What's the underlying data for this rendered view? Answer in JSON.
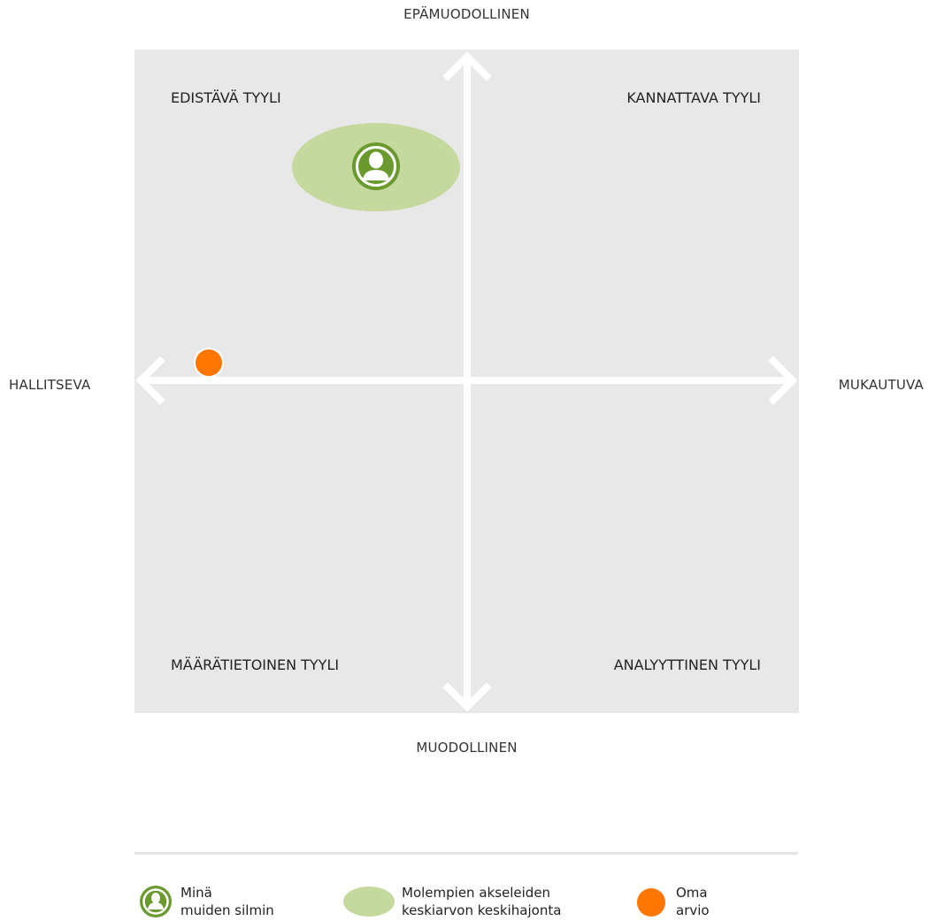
{
  "axes": {
    "top": "EPÄMUODOLLINEN",
    "bottom": "MUODOLLINEN",
    "left": "HALLITSEVA",
    "right": "MUKAUTUVA"
  },
  "quadrants": {
    "top_left": "EDISTÄVÄ TYYLI",
    "top_right": "KANNATTAVA TYYLI",
    "bottom_left": "MÄÄRÄTIETOINEN TYYLI",
    "bottom_right": "ANALYYTTINEN TYYLI"
  },
  "legend": {
    "others_line1": "Minä",
    "others_line2": "muiden silmin",
    "spread_line1": "Molempien akseleiden",
    "spread_line2": "keskiarvon keskihajonta",
    "self_line1": "Oma",
    "self_line2": "arvio"
  },
  "colors": {
    "plot_background": "#e8e8e8",
    "axis": "#ffffff",
    "others_icon": "#6a9a2d",
    "spread_ellipse": "#c5d89d",
    "self_marker": "#ff7700"
  },
  "icons": {
    "others": "person-circle-icon",
    "self": "orange-dot-icon"
  }
}
